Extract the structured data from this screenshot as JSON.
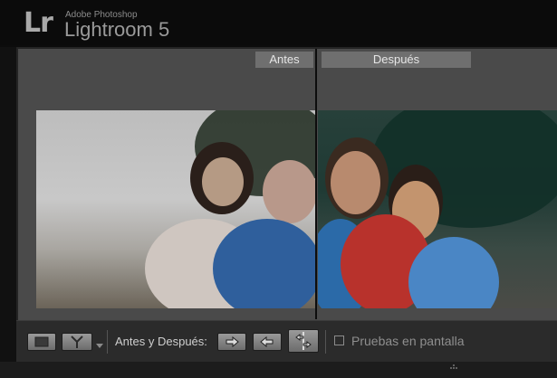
{
  "app": {
    "logo": "Lr",
    "vendor": "Adobe Photoshop",
    "product": "Lightroom 5"
  },
  "view": {
    "before_label": "Antes",
    "after_label": "Después"
  },
  "toolbar": {
    "mode_label": "Antes y Después:",
    "softproof_label": "Pruebas en pantalla",
    "softproof_checked": false
  },
  "icons": {
    "loupe_view": "single-view-icon",
    "before_after_view": "yv-split-icon",
    "dropdown": "chevron-down-icon",
    "copy_before_to_after": "arrow-right-icon",
    "copy_after_to_before": "arrow-left-icon",
    "swap": "swap-icon"
  }
}
